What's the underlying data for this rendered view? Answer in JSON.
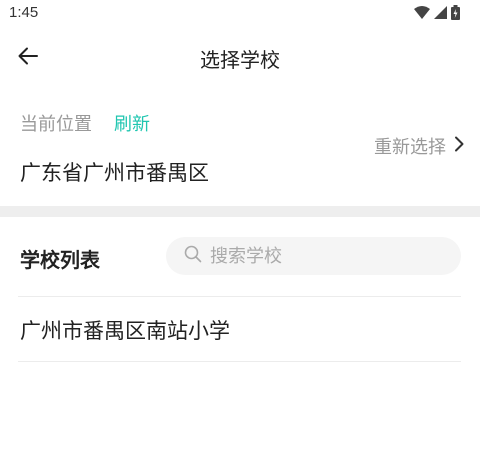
{
  "status_bar": {
    "time": "1:45",
    "icons": [
      "wifi-icon",
      "signal-icon",
      "battery-icon"
    ]
  },
  "header": {
    "back_icon": "arrow-left-icon",
    "title": "选择学校"
  },
  "location": {
    "current_label": "当前位置",
    "refresh_label": "刷新",
    "value": "广东省广州市番禺区",
    "reselect_label": "重新选择",
    "reselect_icon": "chevron-right-icon"
  },
  "school_list": {
    "title": "学校列表",
    "search": {
      "placeholder": "搜索学校",
      "value": "",
      "icon": "search-icon"
    },
    "items": [
      {
        "name": "广州市番禺区南站小学"
      }
    ]
  },
  "colors": {
    "accent": "#1fc6b0",
    "muted_text": "#999999",
    "primary_text": "#222222",
    "divider_band": "#eeeeee",
    "search_bg": "#f5f5f5"
  }
}
